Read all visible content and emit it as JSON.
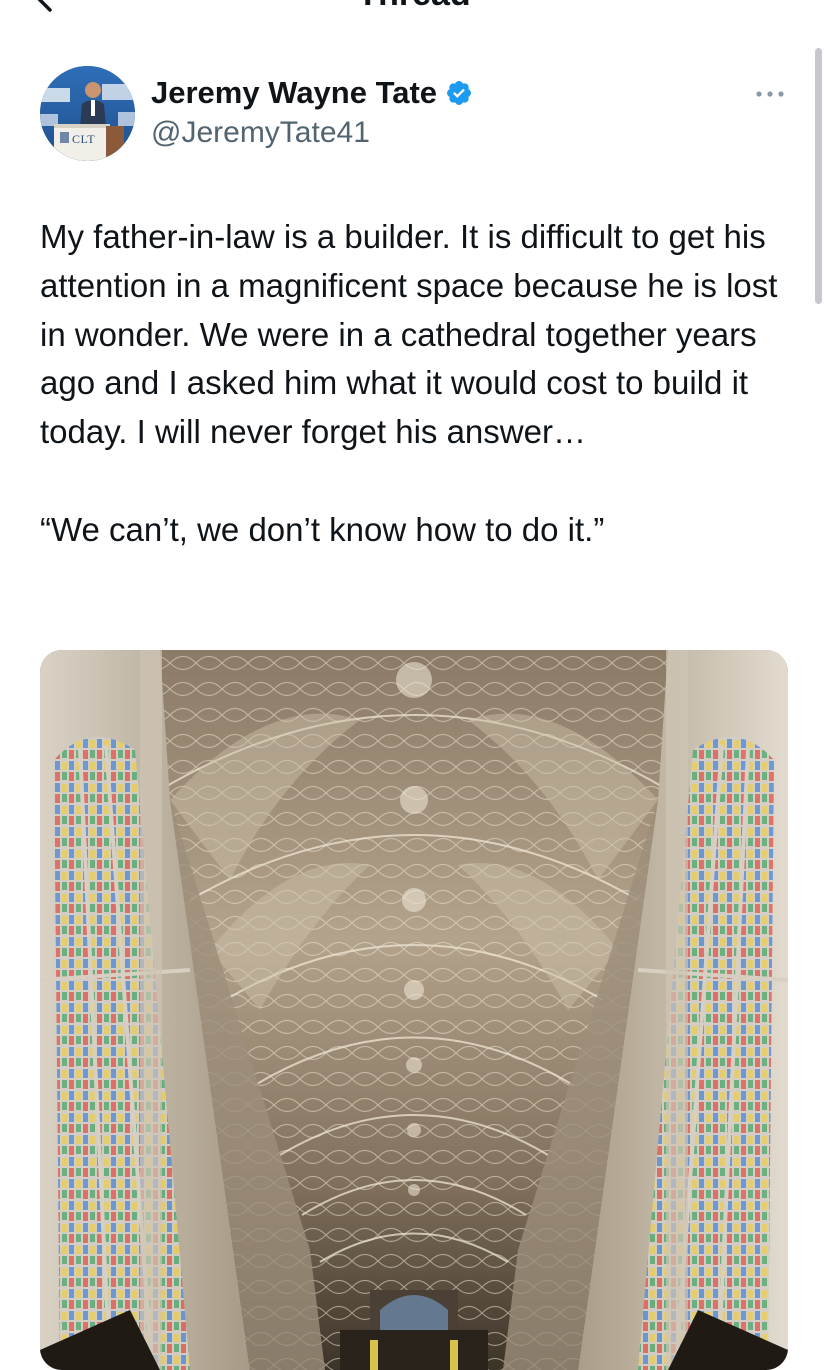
{
  "header": {
    "title": "Thread",
    "back_icon": "chevron-left-icon"
  },
  "tweet": {
    "author_name": "Jeremy Wayne Tate",
    "author_handle": "@JeremyTate41",
    "verified": true,
    "verified_color": "#1d9bf0",
    "paragraphs": [
      "My father-in-law is a builder. It is difficult to get his attention in a magnificent space because he is lost in wonder. We were in a cathedral together years ago and I asked him what it would cost to build it today. I will never forget his answer…",
      "“We can’t, we don’t know how to do it.”"
    ],
    "more_icon": "more-horizontal-icon",
    "media": {
      "type": "photo",
      "alt": "",
      "avatar_sign_text": "CLT"
    }
  },
  "colors": {
    "text_primary": "#0f1419",
    "text_secondary": "#536471",
    "accent": "#1d9bf0"
  }
}
